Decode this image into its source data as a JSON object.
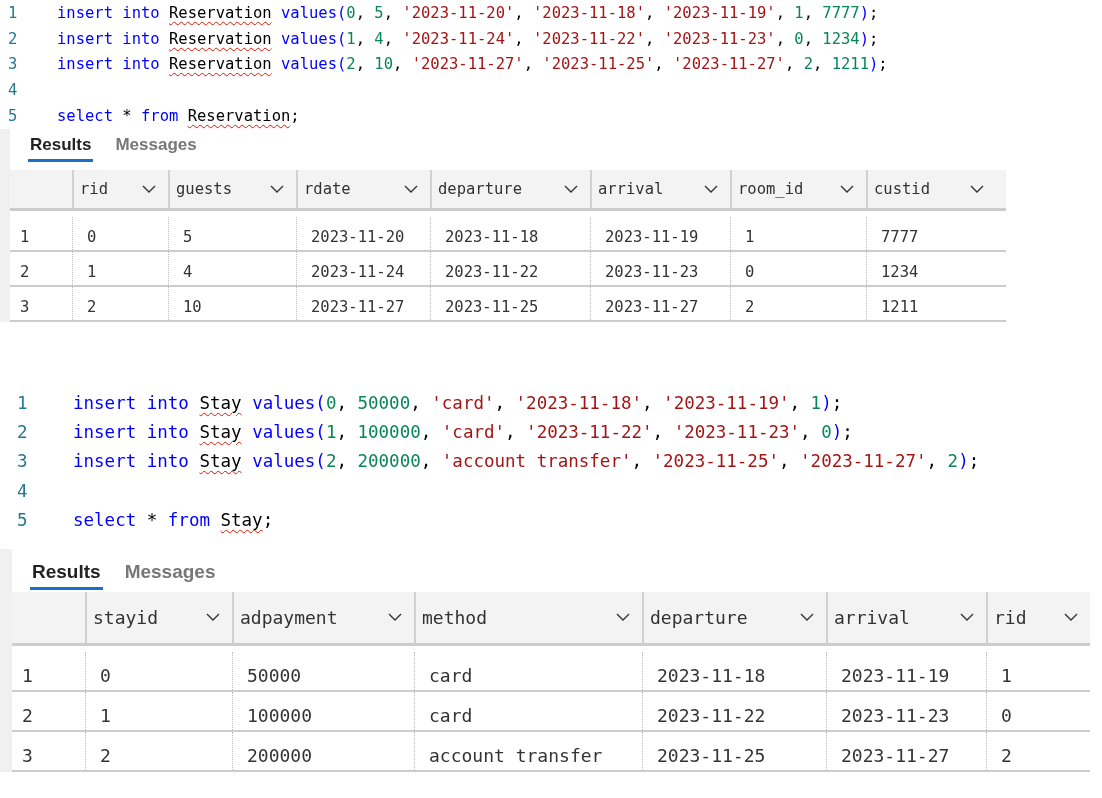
{
  "panels": [
    {
      "code_lines": [
        {
          "number": "1",
          "tokens": [
            {
              "kind": "keyword",
              "text": "insert into "
            },
            {
              "kind": "flagged",
              "text": "Reservation"
            },
            {
              "kind": "keyword",
              "text": " values("
            },
            {
              "kind": "number",
              "text": "0"
            },
            {
              "kind": "plain",
              "text": ", "
            },
            {
              "kind": "number",
              "text": "5"
            },
            {
              "kind": "plain",
              "text": ", "
            },
            {
              "kind": "string",
              "text": "'2023-11-20'"
            },
            {
              "kind": "plain",
              "text": ", "
            },
            {
              "kind": "string",
              "text": "'2023-11-18'"
            },
            {
              "kind": "plain",
              "text": ", "
            },
            {
              "kind": "string",
              "text": "'2023-11-19'"
            },
            {
              "kind": "plain",
              "text": ", "
            },
            {
              "kind": "number",
              "text": "1"
            },
            {
              "kind": "plain",
              "text": ", "
            },
            {
              "kind": "number",
              "text": "7777"
            },
            {
              "kind": "keyword",
              "text": ")"
            },
            {
              "kind": "plain",
              "text": ";"
            }
          ]
        },
        {
          "number": "2",
          "tokens": [
            {
              "kind": "keyword",
              "text": "insert into "
            },
            {
              "kind": "flagged",
              "text": "Reservation"
            },
            {
              "kind": "keyword",
              "text": " values("
            },
            {
              "kind": "number",
              "text": "1"
            },
            {
              "kind": "plain",
              "text": ", "
            },
            {
              "kind": "number",
              "text": "4"
            },
            {
              "kind": "plain",
              "text": ", "
            },
            {
              "kind": "string",
              "text": "'2023-11-24'"
            },
            {
              "kind": "plain",
              "text": ", "
            },
            {
              "kind": "string",
              "text": "'2023-11-22'"
            },
            {
              "kind": "plain",
              "text": ", "
            },
            {
              "kind": "string",
              "text": "'2023-11-23'"
            },
            {
              "kind": "plain",
              "text": ", "
            },
            {
              "kind": "number",
              "text": "0"
            },
            {
              "kind": "plain",
              "text": ", "
            },
            {
              "kind": "number",
              "text": "1234"
            },
            {
              "kind": "keyword",
              "text": ")"
            },
            {
              "kind": "plain",
              "text": ";"
            }
          ]
        },
        {
          "number": "3",
          "tokens": [
            {
              "kind": "keyword",
              "text": "insert into "
            },
            {
              "kind": "flagged",
              "text": "Reservation"
            },
            {
              "kind": "keyword",
              "text": " values("
            },
            {
              "kind": "number",
              "text": "2"
            },
            {
              "kind": "plain",
              "text": ", "
            },
            {
              "kind": "number",
              "text": "10"
            },
            {
              "kind": "plain",
              "text": ", "
            },
            {
              "kind": "string",
              "text": "'2023-11-27'"
            },
            {
              "kind": "plain",
              "text": ", "
            },
            {
              "kind": "string",
              "text": "'2023-11-25'"
            },
            {
              "kind": "plain",
              "text": ", "
            },
            {
              "kind": "string",
              "text": "'2023-11-27'"
            },
            {
              "kind": "plain",
              "text": ", "
            },
            {
              "kind": "number",
              "text": "2"
            },
            {
              "kind": "plain",
              "text": ", "
            },
            {
              "kind": "number",
              "text": "1211"
            },
            {
              "kind": "keyword",
              "text": ")"
            },
            {
              "kind": "plain",
              "text": ";"
            }
          ]
        },
        {
          "number": "4"
        },
        {
          "number": "5",
          "tokens": [
            {
              "kind": "keyword",
              "text": "select"
            },
            {
              "kind": "plain",
              "text": " * "
            },
            {
              "kind": "keyword",
              "text": "from "
            },
            {
              "kind": "flagged",
              "text": "Reservation"
            },
            {
              "kind": "plain",
              "text": ";"
            }
          ]
        }
      ],
      "tabs": [
        {
          "label": "Results",
          "selected": true
        },
        {
          "label": "Messages",
          "selected": false
        }
      ],
      "table": {
        "columns": [
          "rid",
          "guests",
          "rdate",
          "departure",
          "arrival",
          "room_id",
          "custid"
        ],
        "rows": [
          {
            "row_number": "1",
            "cells": [
              "0",
              "5",
              "2023-11-20",
              "2023-11-18",
              "2023-11-19",
              "1",
              "7777"
            ]
          },
          {
            "row_number": "2",
            "cells": [
              "1",
              "4",
              "2023-11-24",
              "2023-11-22",
              "2023-11-23",
              "0",
              "1234"
            ]
          },
          {
            "row_number": "3",
            "cells": [
              "2",
              "10",
              "2023-11-27",
              "2023-11-25",
              "2023-11-27",
              "2",
              "1211"
            ]
          }
        ]
      }
    },
    {
      "code_lines": [
        {
          "number": "1",
          "tokens": [
            {
              "kind": "keyword",
              "text": "insert into "
            },
            {
              "kind": "flagged",
              "text": "Stay"
            },
            {
              "kind": "keyword",
              "text": " values("
            },
            {
              "kind": "number",
              "text": "0"
            },
            {
              "kind": "plain",
              "text": ", "
            },
            {
              "kind": "number",
              "text": "50000"
            },
            {
              "kind": "plain",
              "text": ", "
            },
            {
              "kind": "string",
              "text": "'card'"
            },
            {
              "kind": "plain",
              "text": ", "
            },
            {
              "kind": "string",
              "text": "'2023-11-18'"
            },
            {
              "kind": "plain",
              "text": ", "
            },
            {
              "kind": "string",
              "text": "'2023-11-19'"
            },
            {
              "kind": "plain",
              "text": ", "
            },
            {
              "kind": "number",
              "text": "1"
            },
            {
              "kind": "keyword",
              "text": ")"
            },
            {
              "kind": "plain",
              "text": ";"
            }
          ]
        },
        {
          "number": "2",
          "tokens": [
            {
              "kind": "keyword",
              "text": "insert into "
            },
            {
              "kind": "flagged",
              "text": "Stay"
            },
            {
              "kind": "keyword",
              "text": " values("
            },
            {
              "kind": "number",
              "text": "1"
            },
            {
              "kind": "plain",
              "text": ", "
            },
            {
              "kind": "number",
              "text": "100000"
            },
            {
              "kind": "plain",
              "text": ", "
            },
            {
              "kind": "string",
              "text": "'card'"
            },
            {
              "kind": "plain",
              "text": ", "
            },
            {
              "kind": "string",
              "text": "'2023-11-22'"
            },
            {
              "kind": "plain",
              "text": ", "
            },
            {
              "kind": "string",
              "text": "'2023-11-23'"
            },
            {
              "kind": "plain",
              "text": ", "
            },
            {
              "kind": "number",
              "text": "0"
            },
            {
              "kind": "keyword",
              "text": ")"
            },
            {
              "kind": "plain",
              "text": ";"
            }
          ]
        },
        {
          "number": "3",
          "tokens": [
            {
              "kind": "keyword",
              "text": "insert into "
            },
            {
              "kind": "flagged",
              "text": "Stay"
            },
            {
              "kind": "keyword",
              "text": " values("
            },
            {
              "kind": "number",
              "text": "2"
            },
            {
              "kind": "plain",
              "text": ", "
            },
            {
              "kind": "number",
              "text": "200000"
            },
            {
              "kind": "plain",
              "text": ", "
            },
            {
              "kind": "string",
              "text": "'account transfer'"
            },
            {
              "kind": "plain",
              "text": ", "
            },
            {
              "kind": "string",
              "text": "'2023-11-25'"
            },
            {
              "kind": "plain",
              "text": ", "
            },
            {
              "kind": "string",
              "text": "'2023-11-27'"
            },
            {
              "kind": "plain",
              "text": ", "
            },
            {
              "kind": "number",
              "text": "2"
            },
            {
              "kind": "keyword",
              "text": ")"
            },
            {
              "kind": "plain",
              "text": ";"
            }
          ]
        },
        {
          "number": "4"
        },
        {
          "number": "5",
          "tokens": [
            {
              "kind": "keyword",
              "text": "select"
            },
            {
              "kind": "plain",
              "text": " * "
            },
            {
              "kind": "keyword",
              "text": "from "
            },
            {
              "kind": "flagged",
              "text": "Stay"
            },
            {
              "kind": "plain",
              "text": ";"
            }
          ]
        }
      ],
      "tabs": [
        {
          "label": "Results",
          "selected": true
        },
        {
          "label": "Messages",
          "selected": false
        }
      ],
      "table": {
        "columns": [
          "stayid",
          "adpayment",
          "method",
          "departure",
          "arrival",
          "rid"
        ],
        "rows": [
          {
            "row_number": "1",
            "cells": [
              "0",
              "50000",
              "card",
              "2023-11-18",
              "2023-11-19",
              "1"
            ]
          },
          {
            "row_number": "2",
            "cells": [
              "1",
              "100000",
              "card",
              "2023-11-22",
              "2023-11-23",
              "0"
            ]
          },
          {
            "row_number": "3",
            "cells": [
              "2",
              "200000",
              "account transfer",
              "2023-11-25",
              "2023-11-27",
              "2"
            ]
          }
        ]
      }
    }
  ]
}
